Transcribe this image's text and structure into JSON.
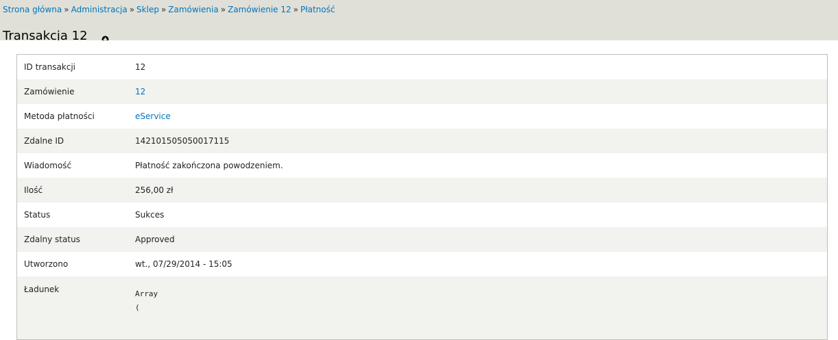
{
  "breadcrumb": {
    "items": [
      "Strona główna",
      "Administracja",
      "Sklep",
      "Zamówienia",
      "Zamówienie 12",
      "Płatność"
    ],
    "separator": "»"
  },
  "page_title": "Transakcja 12",
  "icons": {
    "shortcut": "add-shortcut-icon"
  },
  "colors": {
    "link": "#0074bd",
    "header_bg": "#e0e0d8",
    "stripe": "#f2f2ee"
  },
  "details": {
    "transaction_id_label": "ID transakcji",
    "transaction_id_value": "12",
    "order_label": "Zamówienie",
    "order_value": "12",
    "payment_method_label": "Metoda płatności",
    "payment_method_value": "eService",
    "remote_id_label": "Zdalne ID",
    "remote_id_value": "142101505050017115",
    "message_label": "Wiadomość",
    "message_value": "Płatność zakończona powodzeniem.",
    "amount_label": "Ilość",
    "amount_value": "256,00 zł",
    "status_label": "Status",
    "status_value": "Sukces",
    "remote_status_label": "Zdalny status",
    "remote_status_value": "Approved",
    "created_label": "Utworzono",
    "created_value": "wt., 07/29/2014 - 15:05",
    "payload_label": "Ładunek",
    "payload_value": "Array\n("
  }
}
